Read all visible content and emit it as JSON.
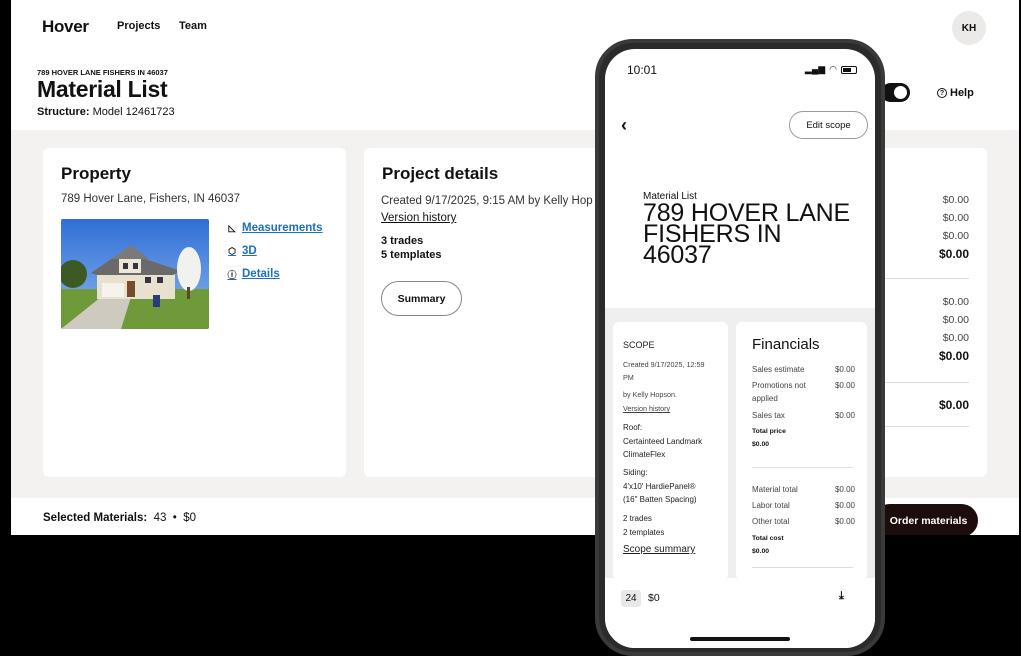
{
  "app": {
    "logo": "Hover",
    "nav": [
      "Projects",
      "Team"
    ],
    "avatar_initials": "KH",
    "help_label": "Help"
  },
  "header": {
    "address_small": "789 HOVER LANE FISHERS IN 46037",
    "title": "Material List",
    "structure_label": "Structure:",
    "structure_value": "Model 12461723"
  },
  "property": {
    "title": "Property",
    "address": "789 Hover Lane, Fishers, IN 46037",
    "links": [
      "Measurements",
      "3D",
      "Details"
    ]
  },
  "project": {
    "title": "Project details",
    "created": "Created 9/17/2025, 9:15 AM by Kelly Hop",
    "version_history": "Version history",
    "trades": "3 trades",
    "templates": "5 templates",
    "summary_button": "Summary"
  },
  "financials_desktop": {
    "values": [
      "$0.00",
      "$0.00",
      "$0.00",
      "$0.00",
      "$0.00",
      "$0.00",
      "$0.00",
      "$0.00",
      "$0.00"
    ]
  },
  "footer": {
    "selected_label": "Selected Materials:",
    "selected_count": "43",
    "separator": "•",
    "selected_amount": "$0",
    "order_button": "Order materials"
  },
  "phone": {
    "time": "10:01",
    "edit_scope": "Edit scope",
    "subtitle": "Material List",
    "title": "789 HOVER LANE FISHERS IN 46037",
    "scope": {
      "label": "SCOPE",
      "created_1": "Created 9/17/2025, 12:59",
      "created_2": "PM",
      "by": "by Kelly Hopson.",
      "version_history": "Version history",
      "roof_label": "Roof:",
      "roof_1": "Certainteed Landmark",
      "roof_2": "ClimateFlex",
      "siding_label": "Siding:",
      "siding_1": "4'x10' HardiePanel®",
      "siding_2": "(16\" Batten Spacing)",
      "trades": "2 trades",
      "templates": "2 templates",
      "summary_link": "Scope summary"
    },
    "financials": {
      "title": "Financials",
      "sales_estimate_label": "Sales estimate",
      "sales_estimate": "$0.00",
      "promotions_label": "Promotions not applied",
      "promotions": "$0.00",
      "sales_tax_label": "Sales tax",
      "sales_tax": "$0.00",
      "total_price_label": "Total price",
      "total_price": "$0.00",
      "material_total_label": "Material total",
      "material_total": "$0.00",
      "labor_total_label": "Labor total",
      "labor_total": "$0.00",
      "other_total_label": "Other total",
      "other_total": "$0.00",
      "total_cost_label": "Total cost",
      "total_cost": "$0.00"
    },
    "footer_count": "24",
    "footer_amount": "$0"
  }
}
